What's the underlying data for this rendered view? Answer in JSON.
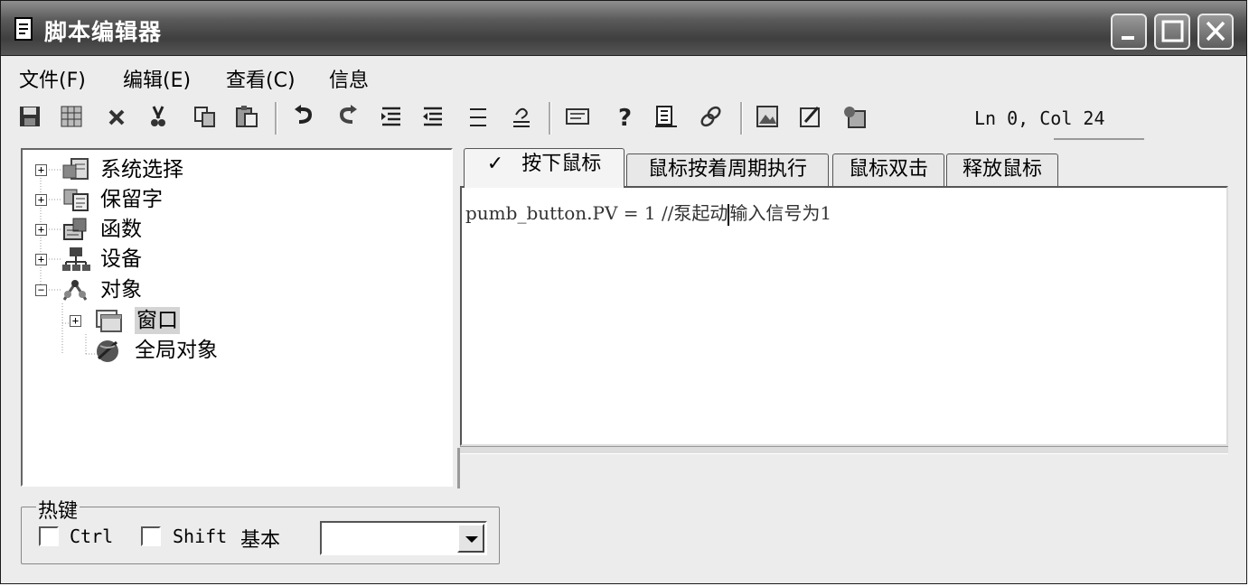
{
  "window": {
    "title": "脚本编辑器",
    "minimize_icon": "minimize-icon",
    "maximize_icon": "maximize-icon",
    "close_icon": "close-icon"
  },
  "menu": [
    "文件(F)",
    "编辑(E)",
    "查看(C)",
    "信息"
  ],
  "toolbar": {
    "icons": [
      "save-icon",
      "grid-icon",
      "delete-icon",
      "cut-icon",
      "copy-icon",
      "paste-icon",
      "undo-icon",
      "redo-icon",
      "indent-icon",
      "outdent-icon",
      "comment-icon",
      "uncomment-icon",
      "label-icon",
      "help-icon",
      "book-icon",
      "link-icon",
      "image-icon",
      "edit-icon",
      "properties-icon"
    ]
  },
  "status": {
    "cursor": "Ln 0, Col 24"
  },
  "tree": {
    "items": [
      {
        "label": "系统选择",
        "expander": "+",
        "icon": "system-select-icon"
      },
      {
        "label": "保留字",
        "expander": "+",
        "icon": "reserved-words-icon"
      },
      {
        "label": "函数",
        "expander": "+",
        "icon": "functions-icon"
      },
      {
        "label": "设备",
        "expander": "+",
        "icon": "devices-icon"
      },
      {
        "label": "对象",
        "expander": "−",
        "icon": "objects-icon"
      },
      {
        "label": "窗口",
        "expander": "+",
        "icon": "window-icon"
      },
      {
        "label": "全局对象",
        "expander": "",
        "icon": "global-object-icon"
      }
    ]
  },
  "tabs": [
    {
      "label": "按下鼠标",
      "check": "✓",
      "active": true
    },
    {
      "label": "鼠标按着周期执行",
      "active": false
    },
    {
      "label": "鼠标双击",
      "active": false
    },
    {
      "label": "释放鼠标",
      "active": false
    }
  ],
  "editor": {
    "code_before_caret": "pumb_button.PV = 1 //泵起动",
    "code_after_caret": "输入信号为1"
  },
  "hotkey": {
    "legend": "热键",
    "ctrl_label": "Ctrl",
    "shift_label": "Shift",
    "basic_label": "基本",
    "combo_value": ""
  }
}
